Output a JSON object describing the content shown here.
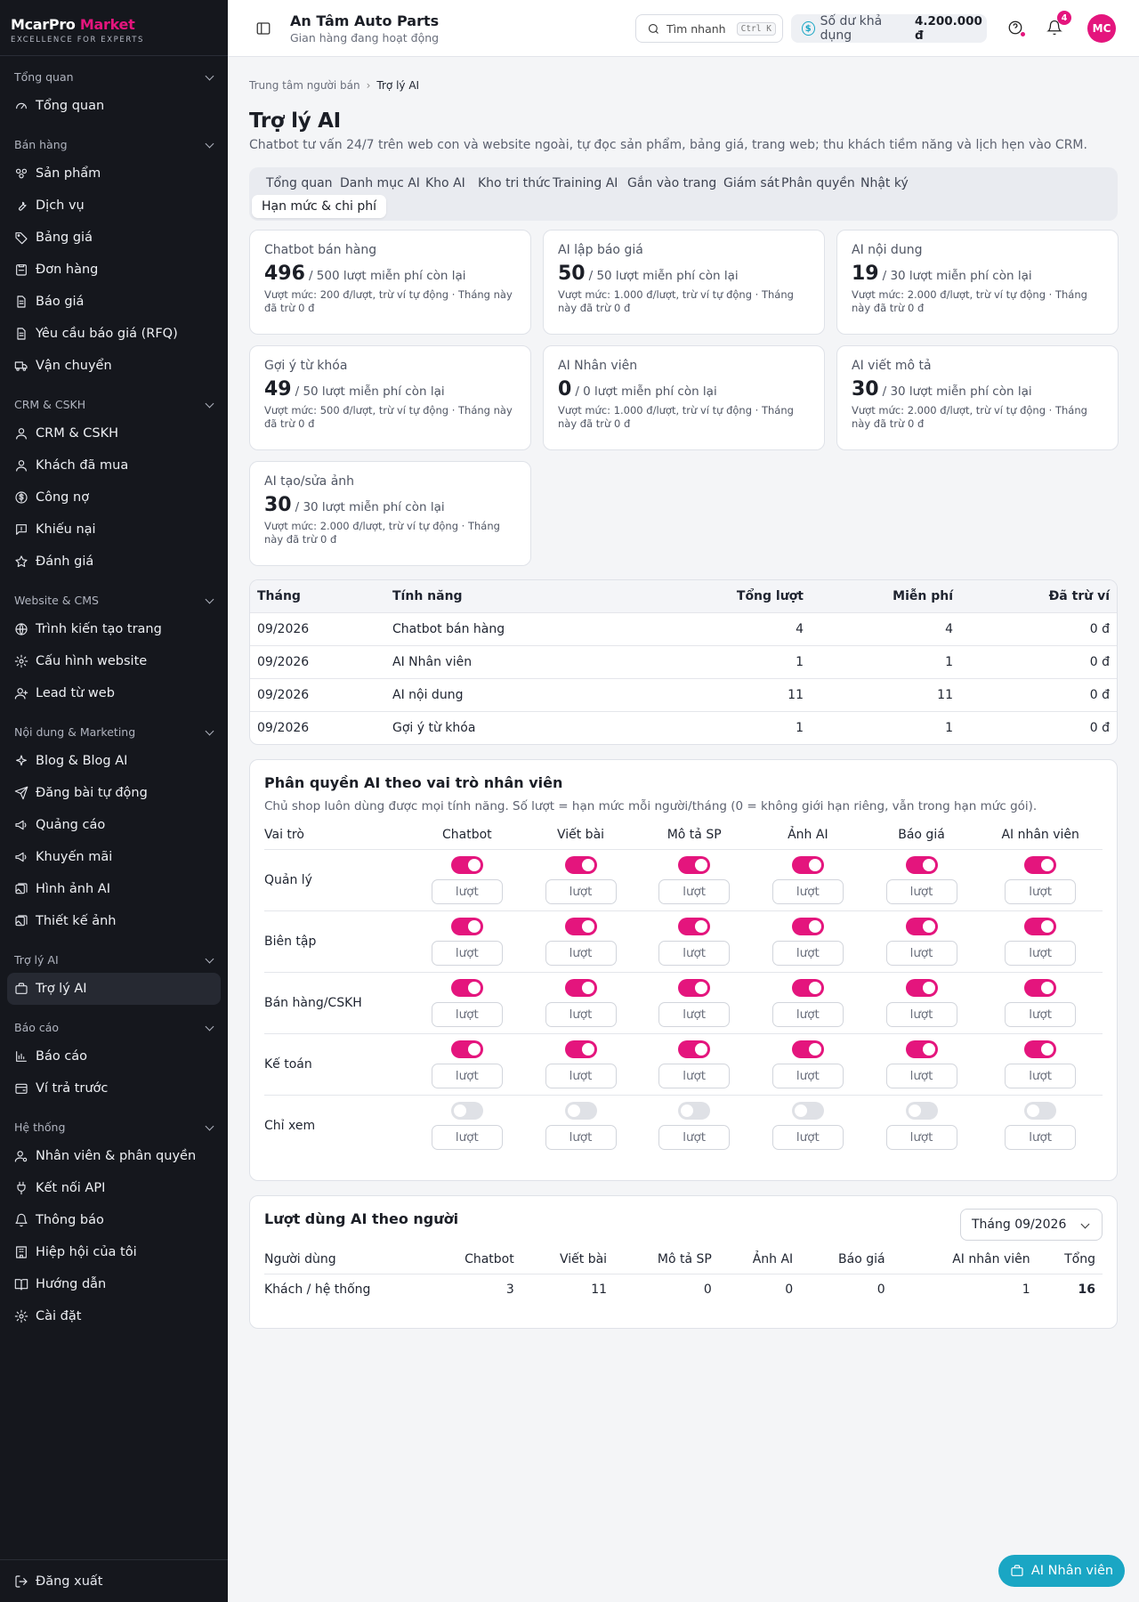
{
  "brand": {
    "name_a": "McarPro",
    "name_b": "Market",
    "tagline": "EXCELLENCE FOR EXPERTS"
  },
  "sidebar": [
    {
      "group": "Tổng quan",
      "items": [
        {
          "label": "Tổng quan",
          "icon": "gauge-icon"
        }
      ]
    },
    {
      "group": "Bán hàng",
      "items": [
        {
          "label": "Sản phẩm",
          "icon": "package-icon"
        },
        {
          "label": "Dịch vụ",
          "icon": "wrench-icon"
        },
        {
          "label": "Bảng giá",
          "icon": "tag-icon"
        },
        {
          "label": "Đơn hàng",
          "icon": "order-icon"
        },
        {
          "label": "Báo giá",
          "icon": "document-icon"
        },
        {
          "label": "Yêu cầu báo giá (RFQ)",
          "icon": "document-icon"
        },
        {
          "label": "Vận chuyển",
          "icon": "truck-icon"
        }
      ]
    },
    {
      "group": "CRM & CSKH",
      "items": [
        {
          "label": "CRM & CSKH",
          "icon": "user-icon"
        },
        {
          "label": "Khách đã mua",
          "icon": "user-icon"
        },
        {
          "label": "Công nợ",
          "icon": "dollar-icon"
        },
        {
          "label": "Khiếu nại",
          "icon": "alert-message-icon"
        },
        {
          "label": "Đánh giá",
          "icon": "star-icon"
        }
      ]
    },
    {
      "group": "Website & CMS",
      "items": [
        {
          "label": "Trình kiến tạo trang",
          "icon": "globe-icon"
        },
        {
          "label": "Cấu hình website",
          "icon": "gear-icon"
        },
        {
          "label": "Lead từ web",
          "icon": "user-plus-icon"
        }
      ]
    },
    {
      "group": "Nội dung & Marketing",
      "items": [
        {
          "label": "Blog & Blog AI",
          "icon": "sparkle-icon"
        },
        {
          "label": "Đăng bài tự động",
          "icon": "send-icon"
        },
        {
          "label": "Quảng cáo",
          "icon": "megaphone-icon"
        },
        {
          "label": "Khuyến mãi",
          "icon": "megaphone-icon"
        },
        {
          "label": "Hình ảnh AI",
          "icon": "images-icon"
        },
        {
          "label": "Thiết kế ảnh",
          "icon": "images-icon"
        }
      ]
    },
    {
      "group": "Trợ lý AI",
      "items": [
        {
          "label": "Trợ lý AI",
          "icon": "briefcase-icon",
          "active": true
        }
      ]
    },
    {
      "group": "Báo cáo",
      "items": [
        {
          "label": "Báo cáo",
          "icon": "bar-chart-icon"
        },
        {
          "label": "Ví trả trước",
          "icon": "wallet-icon"
        }
      ]
    },
    {
      "group": "Hệ thống",
      "items": [
        {
          "label": "Nhân viên & phân quyền",
          "icon": "user-gear-icon"
        },
        {
          "label": "Kết nối API",
          "icon": "plug-icon"
        },
        {
          "label": "Thông báo",
          "icon": "bell-icon"
        },
        {
          "label": "Hiệp hội của tôi",
          "icon": "building-icon"
        },
        {
          "label": "Hướng dẫn",
          "icon": "book-icon"
        },
        {
          "label": "Cài đặt",
          "icon": "gear-icon"
        }
      ]
    }
  ],
  "logout_label": "Đăng xuất",
  "header": {
    "shop_name": "An Tâm Auto Parts",
    "shop_status": "Gian hàng đang hoạt động",
    "search_label": "Tìm nhanh",
    "search_kbd": "Ctrl K",
    "balance_label": "Số dư khả dụng",
    "balance_value": "4.200.000 đ",
    "notif_count": "4",
    "avatar_initials": "MC"
  },
  "breadcrumb": {
    "root": "Trung tâm người bán",
    "current": "Trợ lý AI"
  },
  "page": {
    "title": "Trợ lý AI",
    "subtitle": "Chatbot tư vấn 24/7 trên web con và website ngoài, tự đọc sản phẩm, bảng giá, trang web; thu khách tiềm năng và lịch hẹn vào CRM."
  },
  "tabs": [
    "Tổng quan",
    "Danh mục AI",
    "Kho AI",
    "Kho tri thức",
    "Training AI",
    "Gắn vào trang",
    "Giám sát",
    "Phân quyền",
    "Nhật ký",
    "Hạn mức & chi phí"
  ],
  "active_tab": "Hạn mức & chi phí",
  "quota_cards": [
    {
      "name": "Chatbot bán hàng",
      "remaining": "496",
      "rest": "/ 500 lượt miễn phí còn lại",
      "note": "Vượt mức: 200 đ/lượt, trừ ví tự động · Tháng này đã trừ 0 đ"
    },
    {
      "name": "AI lập báo giá",
      "remaining": "50",
      "rest": "/ 50 lượt miễn phí còn lại",
      "note": "Vượt mức: 1.000 đ/lượt, trừ ví tự động · Tháng này đã trừ 0 đ"
    },
    {
      "name": "AI nội dung",
      "remaining": "19",
      "rest": "/ 30 lượt miễn phí còn lại",
      "note": "Vượt mức: 2.000 đ/lượt, trừ ví tự động · Tháng này đã trừ 0 đ"
    },
    {
      "name": "Gợi ý từ khóa",
      "remaining": "49",
      "rest": "/ 50 lượt miễn phí còn lại",
      "note": "Vượt mức: 500 đ/lượt, trừ ví tự động · Tháng này đã trừ 0 đ"
    },
    {
      "name": "AI Nhân viên",
      "remaining": "0",
      "rest": "/ 0 lượt miễn phí còn lại",
      "note": "Vượt mức: 1.000 đ/lượt, trừ ví tự động · Tháng này đã trừ 0 đ"
    },
    {
      "name": "AI viết mô tả",
      "remaining": "30",
      "rest": "/ 30 lượt miễn phí còn lại",
      "note": "Vượt mức: 2.000 đ/lượt, trừ ví tự động · Tháng này đã trừ 0 đ"
    },
    {
      "name": "AI tạo/sửa ảnh",
      "remaining": "30",
      "rest": "/ 30 lượt miễn phí còn lại",
      "note": "Vượt mức: 2.000 đ/lượt, trừ ví tự động · Tháng này đã trừ 0 đ"
    }
  ],
  "usage_table": {
    "headers": [
      "Tháng",
      "Tính năng",
      "Tổng lượt",
      "Miễn phí",
      "Đã trừ ví"
    ],
    "rows": [
      [
        "09/2026",
        "Chatbot bán hàng",
        "4",
        "4",
        "0 đ"
      ],
      [
        "09/2026",
        "AI Nhân viên",
        "1",
        "1",
        "0 đ"
      ],
      [
        "09/2026",
        "AI nội dung",
        "11",
        "11",
        "0 đ"
      ],
      [
        "09/2026",
        "Gợi ý từ khóa",
        "1",
        "1",
        "0 đ"
      ]
    ]
  },
  "permissions": {
    "title": "Phân quyền AI theo vai trò nhân viên",
    "subtitle": "Chủ shop luôn dùng được mọi tính năng. Số lượt = hạn mức mỗi người/tháng (0 = không giới hạn riêng, vẫn trong hạn mức gói).",
    "headers": [
      "Vai trò",
      "Chatbot",
      "Viết bài",
      "Mô tả SP",
      "Ảnh AI",
      "Báo giá",
      "AI nhân viên"
    ],
    "placeholder": "lượt",
    "roles": [
      {
        "name": "Quản lý",
        "enabled": [
          true,
          true,
          true,
          true,
          true,
          true
        ]
      },
      {
        "name": "Biên tập",
        "enabled": [
          true,
          true,
          true,
          true,
          true,
          true
        ]
      },
      {
        "name": "Bán hàng/CSKH",
        "enabled": [
          true,
          true,
          true,
          true,
          true,
          true
        ]
      },
      {
        "name": "Kế toán",
        "enabled": [
          true,
          true,
          true,
          true,
          true,
          true
        ]
      },
      {
        "name": "Chỉ xem",
        "enabled": [
          false,
          false,
          false,
          false,
          false,
          false
        ]
      }
    ]
  },
  "per_user": {
    "title": "Lượt dùng AI theo người",
    "month": "Tháng 09/2026",
    "headers": [
      "Người dùng",
      "Chatbot",
      "Viết bài",
      "Mô tả SP",
      "Ảnh AI",
      "Báo giá",
      "AI nhân viên",
      "Tổng"
    ],
    "rows": [
      [
        "Khách / hệ thống",
        "3",
        "11",
        "0",
        "0",
        "0",
        "1",
        "16"
      ]
    ]
  },
  "fab_label": "AI Nhân viên",
  "colors": {
    "accent": "#e4157d",
    "teal": "#1aa6c4",
    "sidebar_bg": "#15171d"
  }
}
